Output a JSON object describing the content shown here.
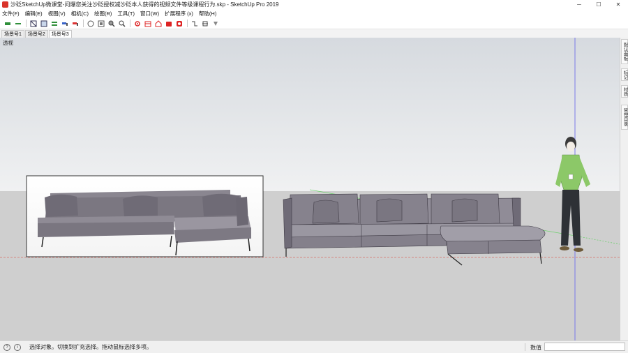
{
  "window": {
    "title": "沙砭SketchUp微课堂-问爆您关注沙砭授权减沙砭本人获得的视频文件等级课程行为.skp - SketchUp Pro 2019",
    "minimize_glyph": "─",
    "maximize_glyph": "☐",
    "close_glyph": "✕"
  },
  "menu": {
    "items": [
      "文件(F)",
      "编辑(E)",
      "视图(V)",
      "相机(C)",
      "绘图(R)",
      "工具(T)",
      "窗口(W)",
      "扩展程序 (x)",
      "帮助(H)"
    ]
  },
  "toolbar": {
    "icons": [
      "select-icon",
      "line-icon",
      "rectangle-icon",
      "push-pull-icon",
      "move-icon",
      "paint-icon",
      "eraser-icon",
      "orbit-icon",
      "pan-icon",
      "zoom-icon",
      "zoom-extents-icon",
      "settings-icon",
      "component-icon",
      "warehouse-icon",
      "extension-icon",
      "layout-icon",
      "section-icon",
      "section-display-icon",
      "section-fill-icon"
    ]
  },
  "scenes": {
    "tabs": [
      "场景号1",
      "场景号2",
      "场景号3"
    ],
    "active_index": 2
  },
  "viewport": {
    "perspective_label": "透视",
    "sky_top": "#dcdfe3",
    "sky_bottom": "#eff0f1",
    "ground": "#cfcfcf",
    "blue_axis": "#7a7ae8",
    "red_axis": "#d8706a",
    "green_axis": "#6fcf6f"
  },
  "tray": {
    "tabs": [
      "默认面板",
      "标记",
      "材质",
      "管理目录"
    ]
  },
  "status": {
    "info_glyph": "i",
    "help_glyph": "?",
    "message": "选择对象。切换到扩充选择。拖动鼠标选择多项。",
    "measurements_label": "数值",
    "measurements_value": ""
  }
}
